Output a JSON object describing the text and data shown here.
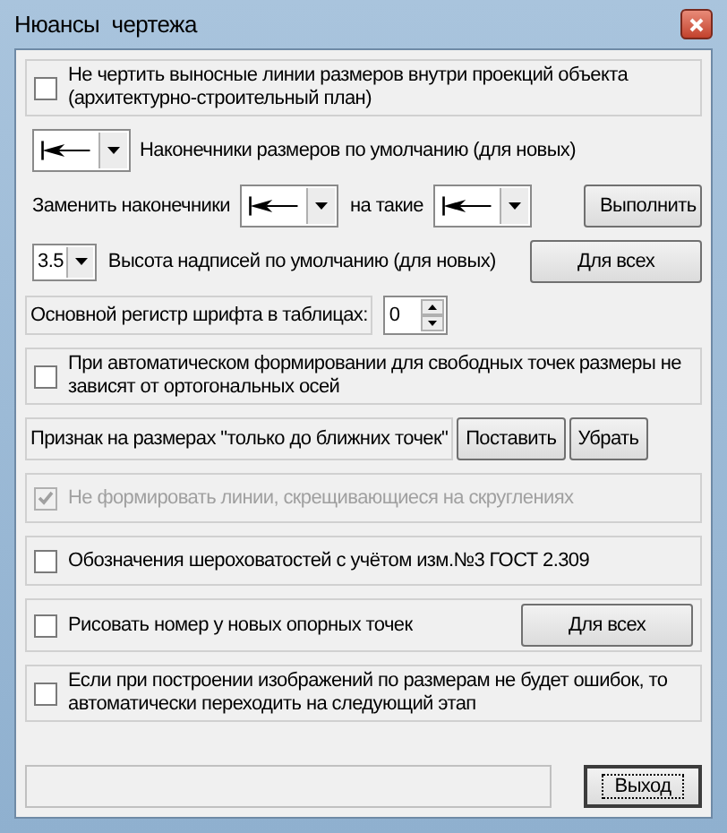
{
  "window": {
    "title": "Нюансы  чертежа"
  },
  "option_architectural": {
    "label": "Не чертить выносные линии размеров внутри проекций объекта (архитектурно-строительный план)",
    "checked": false,
    "disabled": false
  },
  "default_arrowheads": {
    "label": "Наконечники размеров по умолчанию (для новых)"
  },
  "replace_arrowheads": {
    "label": "Заменить наконечники",
    "to_label": "на такие",
    "button": "Выполнить"
  },
  "text_height": {
    "value": "3.5",
    "label": "Высота надписей по умолчанию (для новых)",
    "button": "Для всех"
  },
  "font_case": {
    "label": "Основной регистр шрифта в таблицах:",
    "value": "0"
  },
  "option_free_points": {
    "label": "При автоматическом формировании для свободных точек размеры не зависят от ортогональных осей",
    "checked": false,
    "disabled": false
  },
  "nearest_points": {
    "label": "Признак на размерах \"только до ближних точек\"",
    "buttons": [
      "Поставить",
      "Убрать"
    ]
  },
  "option_fillets": {
    "label": "Не формировать линии, скрещивающиеся на скруглениях",
    "checked": true,
    "disabled": true
  },
  "option_roughness": {
    "label": "Обозначения  шероховатостей  с  учётом  изм.№3  ГОСТ  2.309",
    "checked": false,
    "disabled": false
  },
  "option_point_numbers": {
    "label": "Рисовать номер у новых опорных точек",
    "checked": false,
    "disabled": false,
    "button": "Для всех"
  },
  "option_auto_next": {
    "label": "Если при построении изображений по размерам не будет ошибок, то автоматически переходить на следующий этап",
    "checked": false,
    "disabled": false
  },
  "exit_button": "Выход"
}
